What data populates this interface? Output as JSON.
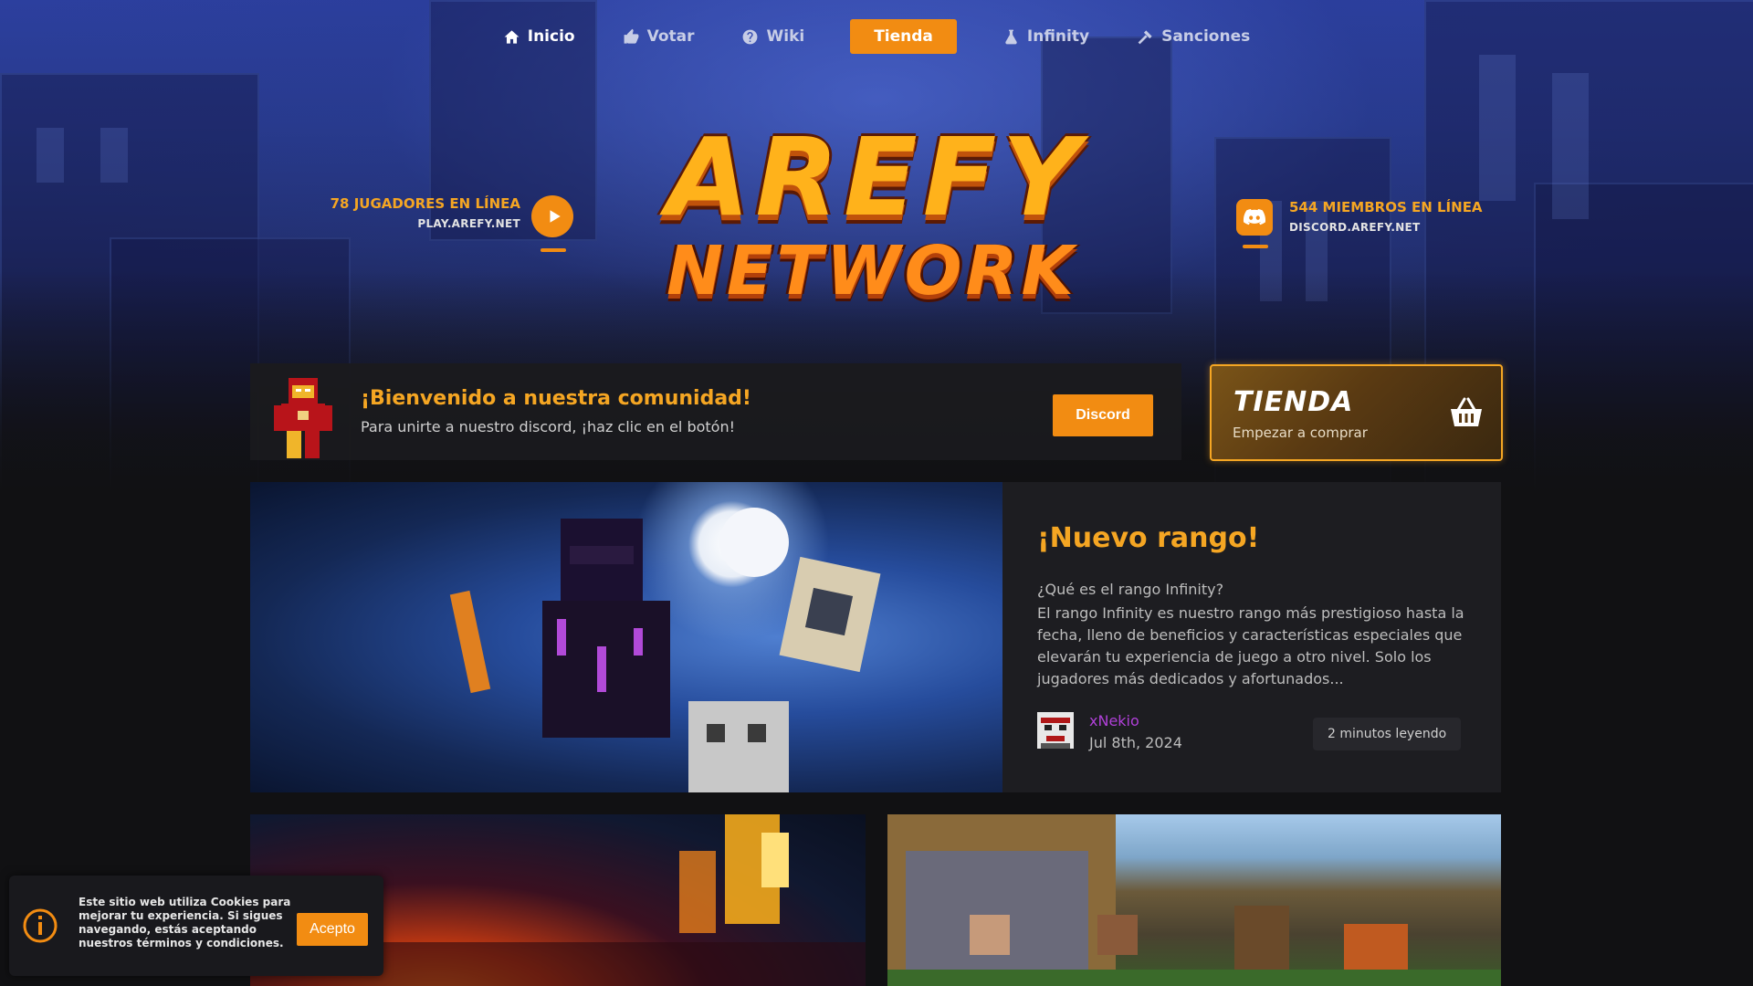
{
  "nav": {
    "items": [
      {
        "label": "Inicio",
        "icon": "home-icon"
      },
      {
        "label": "Votar",
        "icon": "thumbs-up-icon"
      },
      {
        "label": "Wiki",
        "icon": "question-icon"
      },
      {
        "label": "Tienda",
        "icon": ""
      },
      {
        "label": "Infinity",
        "icon": "flask-icon"
      },
      {
        "label": "Sanciones",
        "icon": "hammer-icon"
      }
    ]
  },
  "logo": {
    "line1": "AREFY",
    "line2": "NETWORK"
  },
  "server": {
    "players": "78 JUGADORES EN LÍNEA",
    "address": "PLAY.AREFY.NET"
  },
  "discord": {
    "members": "544 MIEMBROS EN LÍNEA",
    "address": "DISCORD.AREFY.NET"
  },
  "welcome": {
    "title": "¡Bienvenido a nuestra comunidad!",
    "subtitle": "Para unirte a nuestro discord, ¡haz clic en el botón!",
    "button": "Discord"
  },
  "shop_card": {
    "title": "TIENDA",
    "subtitle": "Empezar a comprar"
  },
  "post": {
    "title": "¡Nuevo rango!",
    "question": "¿Qué es el rango Infinity?",
    "body": "El rango Infinity es nuestro rango más prestigioso hasta la fecha, lleno de beneficios y características especiales que elevarán tu experiencia de juego a otro nivel. Solo los jugadores más dedicados y afortunados...",
    "author": "xNekio",
    "date": "Jul 8th, 2024",
    "read_time": "2 minutos leyendo"
  },
  "cookie": {
    "text": "Este sitio web utiliza Cookies para mejorar tu experiencia. Si sigues navegando, estás aceptando nuestros términos y condiciones.",
    "button": "Acepto"
  },
  "colors": {
    "accent": "#f28c12",
    "accent_text": "#f5a623",
    "author": "#b040d8",
    "background": "#111113"
  }
}
